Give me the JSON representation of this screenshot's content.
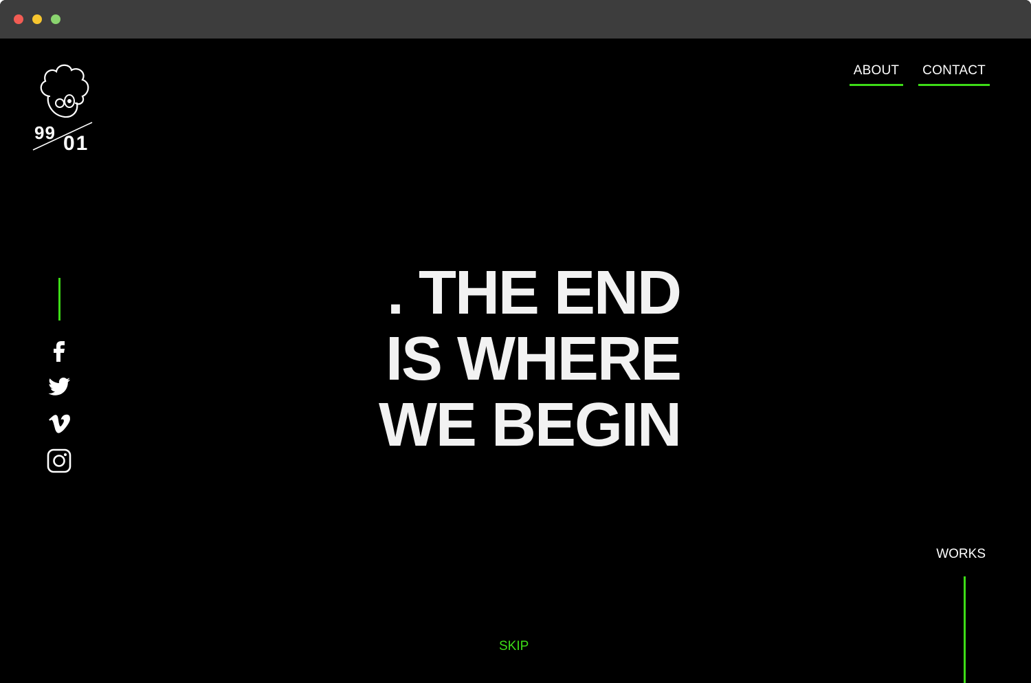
{
  "window": {
    "controls": [
      "close",
      "minimize",
      "maximize"
    ]
  },
  "logo": {
    "alt_text": "9901",
    "icon": "mascot-logo-icon"
  },
  "nav": {
    "items": [
      {
        "label": "ABOUT"
      },
      {
        "label": "CONTACT"
      }
    ]
  },
  "social": {
    "icons": [
      "facebook-icon",
      "twitter-icon",
      "vimeo-icon",
      "instagram-icon"
    ]
  },
  "hero": {
    "lines": [
      ". THE END",
      "IS WHERE",
      "WE BEGIN"
    ]
  },
  "works": {
    "label": "WORKS"
  },
  "skip": {
    "label": "SKIP"
  },
  "colors": {
    "accent": "#3ddc17",
    "background": "#000000",
    "text": "#f2f2f2",
    "titlebar": "#3d3d3d"
  }
}
